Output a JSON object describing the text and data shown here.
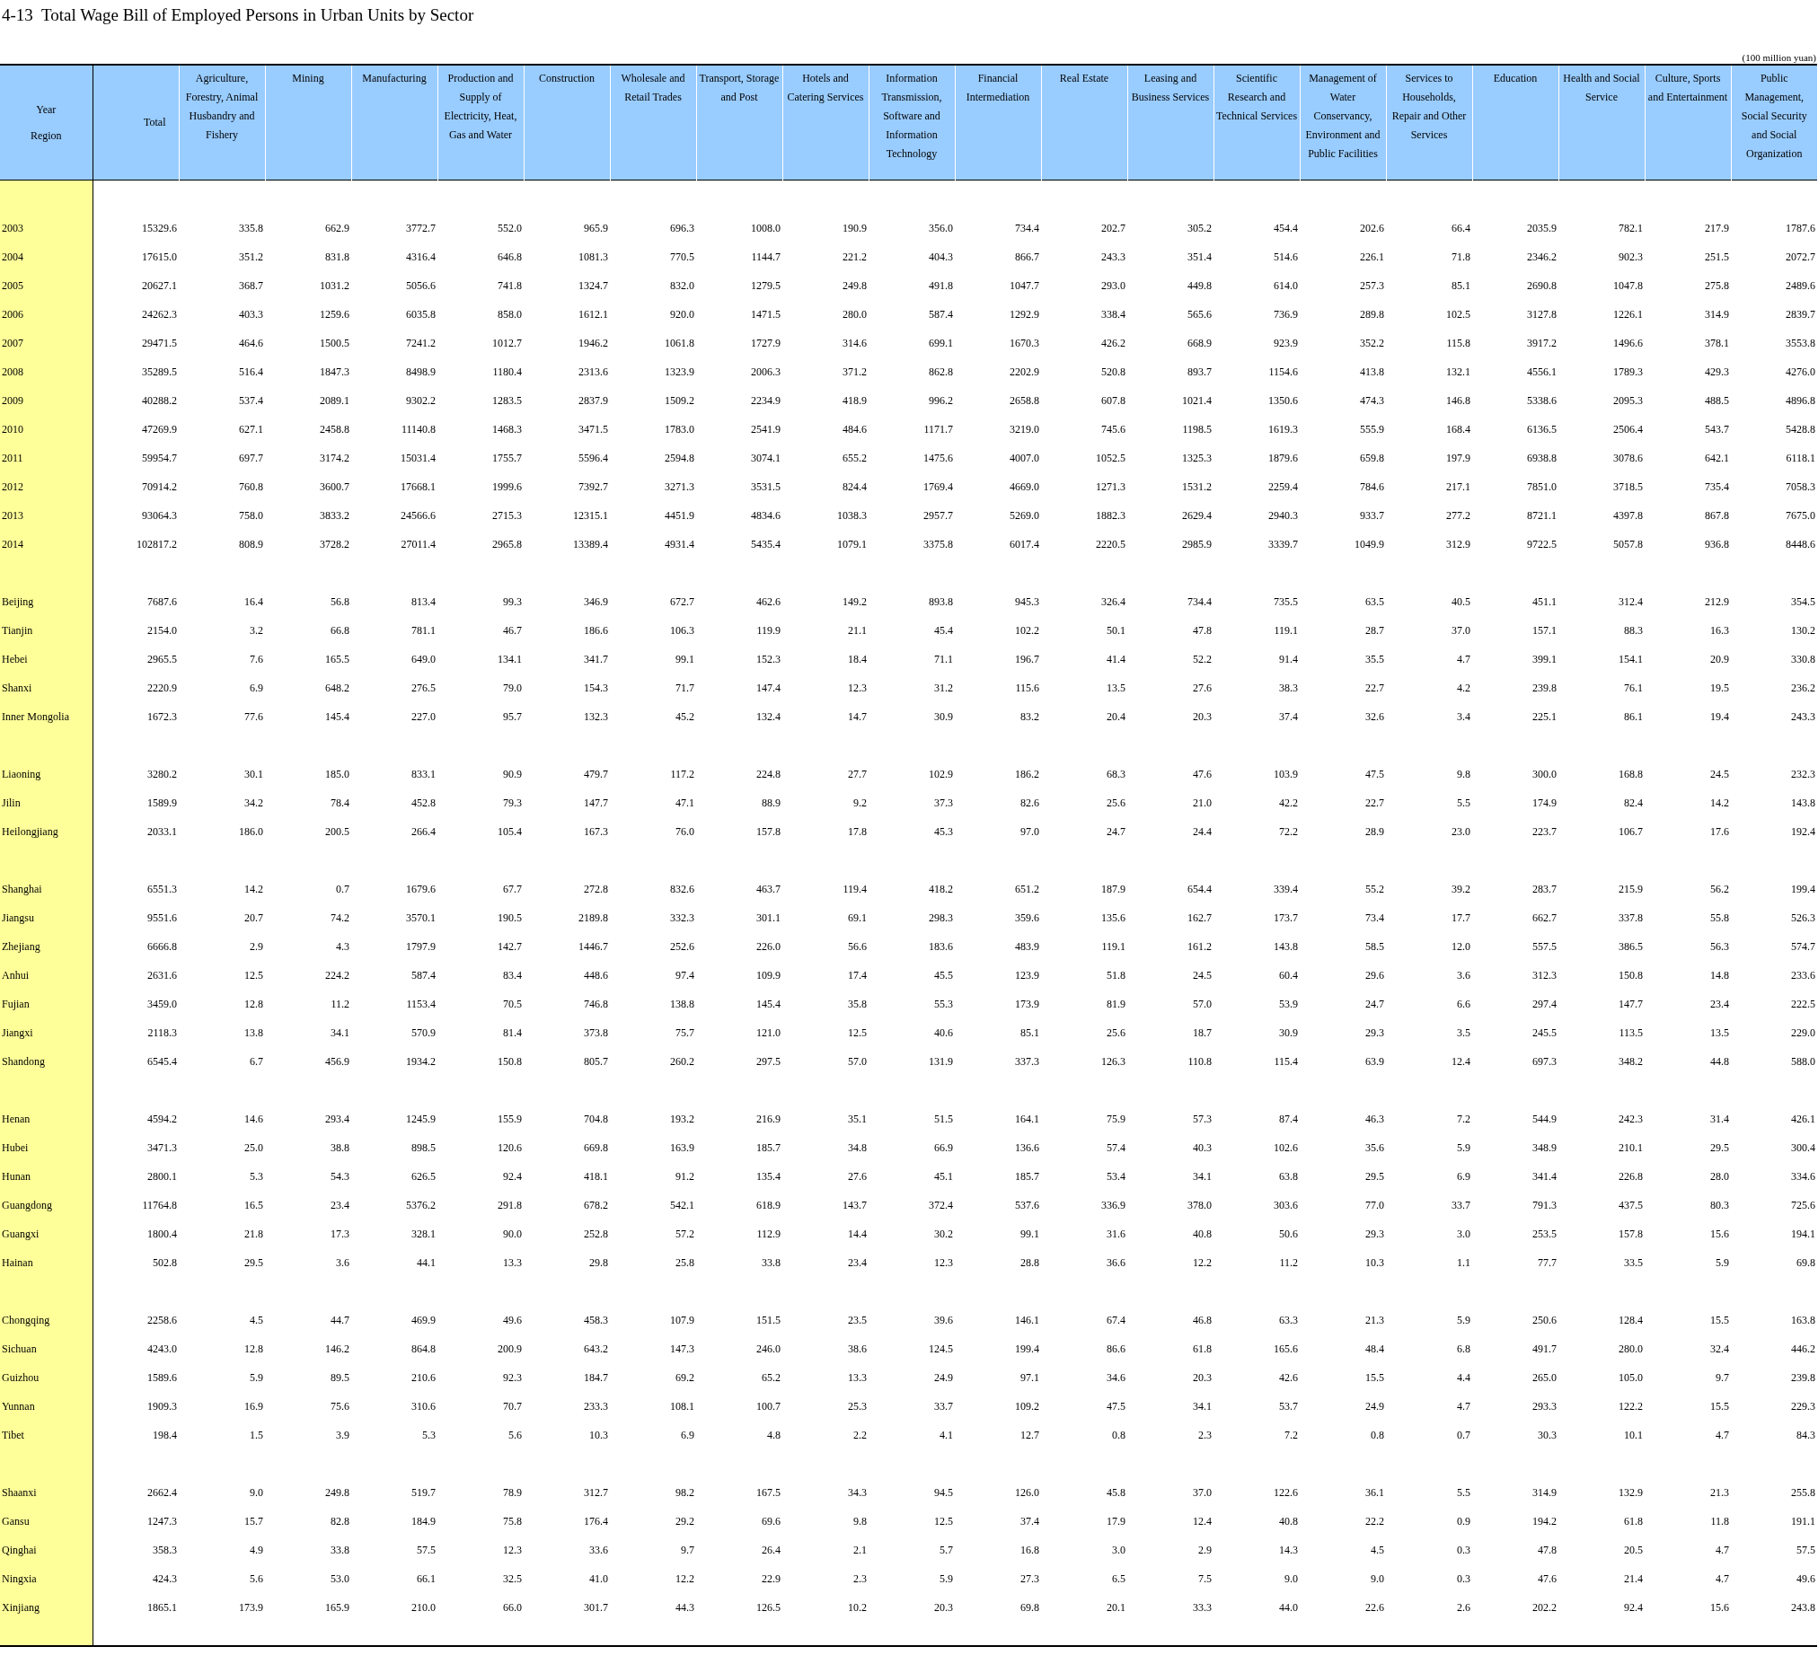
{
  "title": "4-13  Total Wage Bill of Employed Persons in Urban Units by Sector",
  "unit": "(100 million yuan)",
  "corner": {
    "top": "Year",
    "bottom": "Region"
  },
  "columns": [
    "Total",
    "Agriculture, Forestry, Animal Husbandry and Fishery",
    "Mining",
    "Manufacturing",
    "Production and Supply of Electricity, Heat, Gas and Water",
    "Construction",
    "Wholesale and Retail Trades",
    "Transport, Storage and Post",
    "Hotels and Catering Services",
    "Information Transmission, Software and Information Technology",
    "Financial Intermediation",
    "Real Estate",
    "Leasing and Business Services",
    "Scientific Research and Technical Services",
    "Management of Water Conservancy, Environment and Public Facilities",
    "Services to Households, Repair and Other Services",
    "Education",
    "Health and Social Service",
    "Culture, Sports and Entertainment",
    "Public Management, Social Security and Social Organization"
  ],
  "sections": [
    {
      "rows": [
        {
          "label": "2003",
          "values": [
            "15329.6",
            "335.8",
            "662.9",
            "3772.7",
            "552.0",
            "965.9",
            "696.3",
            "1008.0",
            "190.9",
            "356.0",
            "734.4",
            "202.7",
            "305.2",
            "454.4",
            "202.6",
            "66.4",
            "2035.9",
            "782.1",
            "217.9",
            "1787.6"
          ]
        },
        {
          "label": "2004",
          "values": [
            "17615.0",
            "351.2",
            "831.8",
            "4316.4",
            "646.8",
            "1081.3",
            "770.5",
            "1144.7",
            "221.2",
            "404.3",
            "866.7",
            "243.3",
            "351.4",
            "514.6",
            "226.1",
            "71.8",
            "2346.2",
            "902.3",
            "251.5",
            "2072.7"
          ]
        },
        {
          "label": "2005",
          "values": [
            "20627.1",
            "368.7",
            "1031.2",
            "5056.6",
            "741.8",
            "1324.7",
            "832.0",
            "1279.5",
            "249.8",
            "491.8",
            "1047.7",
            "293.0",
            "449.8",
            "614.0",
            "257.3",
            "85.1",
            "2690.8",
            "1047.8",
            "275.8",
            "2489.6"
          ]
        },
        {
          "label": "2006",
          "values": [
            "24262.3",
            "403.3",
            "1259.6",
            "6035.8",
            "858.0",
            "1612.1",
            "920.0",
            "1471.5",
            "280.0",
            "587.4",
            "1292.9",
            "338.4",
            "565.6",
            "736.9",
            "289.8",
            "102.5",
            "3127.8",
            "1226.1",
            "314.9",
            "2839.7"
          ]
        },
        {
          "label": "2007",
          "values": [
            "29471.5",
            "464.6",
            "1500.5",
            "7241.2",
            "1012.7",
            "1946.2",
            "1061.8",
            "1727.9",
            "314.6",
            "699.1",
            "1670.3",
            "426.2",
            "668.9",
            "923.9",
            "352.2",
            "115.8",
            "3917.2",
            "1496.6",
            "378.1",
            "3553.8"
          ]
        },
        {
          "label": "2008",
          "values": [
            "35289.5",
            "516.4",
            "1847.3",
            "8498.9",
            "1180.4",
            "2313.6",
            "1323.9",
            "2006.3",
            "371.2",
            "862.8",
            "2202.9",
            "520.8",
            "893.7",
            "1154.6",
            "413.8",
            "132.1",
            "4556.1",
            "1789.3",
            "429.3",
            "4276.0"
          ]
        },
        {
          "label": "2009",
          "values": [
            "40288.2",
            "537.4",
            "2089.1",
            "9302.2",
            "1283.5",
            "2837.9",
            "1509.2",
            "2234.9",
            "418.9",
            "996.2",
            "2658.8",
            "607.8",
            "1021.4",
            "1350.6",
            "474.3",
            "146.8",
            "5338.6",
            "2095.3",
            "488.5",
            "4896.8"
          ]
        },
        {
          "label": "2010",
          "values": [
            "47269.9",
            "627.1",
            "2458.8",
            "11140.8",
            "1468.3",
            "3471.5",
            "1783.0",
            "2541.9",
            "484.6",
            "1171.7",
            "3219.0",
            "745.6",
            "1198.5",
            "1619.3",
            "555.9",
            "168.4",
            "6136.5",
            "2506.4",
            "543.7",
            "5428.8"
          ]
        },
        {
          "label": "2011",
          "values": [
            "59954.7",
            "697.7",
            "3174.2",
            "15031.4",
            "1755.7",
            "5596.4",
            "2594.8",
            "3074.1",
            "655.2",
            "1475.6",
            "4007.0",
            "1052.5",
            "1325.3",
            "1879.6",
            "659.8",
            "197.9",
            "6938.8",
            "3078.6",
            "642.1",
            "6118.1"
          ]
        },
        {
          "label": "2012",
          "values": [
            "70914.2",
            "760.8",
            "3600.7",
            "17668.1",
            "1999.6",
            "7392.7",
            "3271.3",
            "3531.5",
            "824.4",
            "1769.4",
            "4669.0",
            "1271.3",
            "1531.2",
            "2259.4",
            "784.6",
            "217.1",
            "7851.0",
            "3718.5",
            "735.4",
            "7058.3"
          ]
        },
        {
          "label": "2013",
          "values": [
            "93064.3",
            "758.0",
            "3833.2",
            "24566.6",
            "2715.3",
            "12315.1",
            "4451.9",
            "4834.6",
            "1038.3",
            "2957.7",
            "5269.0",
            "1882.3",
            "2629.4",
            "2940.3",
            "933.7",
            "277.2",
            "8721.1",
            "4397.8",
            "867.8",
            "7675.0"
          ]
        },
        {
          "label": "2014",
          "values": [
            "102817.2",
            "808.9",
            "3728.2",
            "27011.4",
            "2965.8",
            "13389.4",
            "4931.4",
            "5435.4",
            "1079.1",
            "3375.8",
            "6017.4",
            "2220.5",
            "2985.9",
            "3339.7",
            "1049.9",
            "312.9",
            "9722.5",
            "5057.8",
            "936.8",
            "8448.6"
          ]
        }
      ]
    },
    {
      "rows": [
        {
          "label": "Beijing",
          "values": [
            "7687.6",
            "16.4",
            "56.8",
            "813.4",
            "99.3",
            "346.9",
            "672.7",
            "462.6",
            "149.2",
            "893.8",
            "945.3",
            "326.4",
            "734.4",
            "735.5",
            "63.5",
            "40.5",
            "451.1",
            "312.4",
            "212.9",
            "354.5"
          ]
        },
        {
          "label": "Tianjin",
          "values": [
            "2154.0",
            "3.2",
            "66.8",
            "781.1",
            "46.7",
            "186.6",
            "106.3",
            "119.9",
            "21.1",
            "45.4",
            "102.2",
            "50.1",
            "47.8",
            "119.1",
            "28.7",
            "37.0",
            "157.1",
            "88.3",
            "16.3",
            "130.2"
          ]
        },
        {
          "label": "Hebei",
          "values": [
            "2965.5",
            "7.6",
            "165.5",
            "649.0",
            "134.1",
            "341.7",
            "99.1",
            "152.3",
            "18.4",
            "71.1",
            "196.7",
            "41.4",
            "52.2",
            "91.4",
            "35.5",
            "4.7",
            "399.1",
            "154.1",
            "20.9",
            "330.8"
          ]
        },
        {
          "label": "Shanxi",
          "values": [
            "2220.9",
            "6.9",
            "648.2",
            "276.5",
            "79.0",
            "154.3",
            "71.7",
            "147.4",
            "12.3",
            "31.2",
            "115.6",
            "13.5",
            "27.6",
            "38.3",
            "22.7",
            "4.2",
            "239.8",
            "76.1",
            "19.5",
            "236.2"
          ]
        },
        {
          "label": "Inner Mongolia",
          "values": [
            "1672.3",
            "77.6",
            "145.4",
            "227.0",
            "95.7",
            "132.3",
            "45.2",
            "132.4",
            "14.7",
            "30.9",
            "83.2",
            "20.4",
            "20.3",
            "37.4",
            "32.6",
            "3.4",
            "225.1",
            "86.1",
            "19.4",
            "243.3"
          ]
        }
      ]
    },
    {
      "rows": [
        {
          "label": "Liaoning",
          "values": [
            "3280.2",
            "30.1",
            "185.0",
            "833.1",
            "90.9",
            "479.7",
            "117.2",
            "224.8",
            "27.7",
            "102.9",
            "186.2",
            "68.3",
            "47.6",
            "103.9",
            "47.5",
            "9.8",
            "300.0",
            "168.8",
            "24.5",
            "232.3"
          ]
        },
        {
          "label": "Jilin",
          "values": [
            "1589.9",
            "34.2",
            "78.4",
            "452.8",
            "79.3",
            "147.7",
            "47.1",
            "88.9",
            "9.2",
            "37.3",
            "82.6",
            "25.6",
            "21.0",
            "42.2",
            "22.7",
            "5.5",
            "174.9",
            "82.4",
            "14.2",
            "143.8"
          ]
        },
        {
          "label": "Heilongjiang",
          "values": [
            "2033.1",
            "186.0",
            "200.5",
            "266.4",
            "105.4",
            "167.3",
            "76.0",
            "157.8",
            "17.8",
            "45.3",
            "97.0",
            "24.7",
            "24.4",
            "72.2",
            "28.9",
            "23.0",
            "223.7",
            "106.7",
            "17.6",
            "192.4"
          ]
        }
      ]
    },
    {
      "rows": [
        {
          "label": "Shanghai",
          "values": [
            "6551.3",
            "14.2",
            "0.7",
            "1679.6",
            "67.7",
            "272.8",
            "832.6",
            "463.7",
            "119.4",
            "418.2",
            "651.2",
            "187.9",
            "654.4",
            "339.4",
            "55.2",
            "39.2",
            "283.7",
            "215.9",
            "56.2",
            "199.4"
          ]
        },
        {
          "label": "Jiangsu",
          "values": [
            "9551.6",
            "20.7",
            "74.2",
            "3570.1",
            "190.5",
            "2189.8",
            "332.3",
            "301.1",
            "69.1",
            "298.3",
            "359.6",
            "135.6",
            "162.7",
            "173.7",
            "73.4",
            "17.7",
            "662.7",
            "337.8",
            "55.8",
            "526.3"
          ]
        },
        {
          "label": "Zhejiang",
          "values": [
            "6666.8",
            "2.9",
            "4.3",
            "1797.9",
            "142.7",
            "1446.7",
            "252.6",
            "226.0",
            "56.6",
            "183.6",
            "483.9",
            "119.1",
            "161.2",
            "143.8",
            "58.5",
            "12.0",
            "557.5",
            "386.5",
            "56.3",
            "574.7"
          ]
        },
        {
          "label": "Anhui",
          "values": [
            "2631.6",
            "12.5",
            "224.2",
            "587.4",
            "83.4",
            "448.6",
            "97.4",
            "109.9",
            "17.4",
            "45.5",
            "123.9",
            "51.8",
            "24.5",
            "60.4",
            "29.6",
            "3.6",
            "312.3",
            "150.8",
            "14.8",
            "233.6"
          ]
        },
        {
          "label": "Fujian",
          "values": [
            "3459.0",
            "12.8",
            "11.2",
            "1153.4",
            "70.5",
            "746.8",
            "138.8",
            "145.4",
            "35.8",
            "55.3",
            "173.9",
            "81.9",
            "57.0",
            "53.9",
            "24.7",
            "6.6",
            "297.4",
            "147.7",
            "23.4",
            "222.5"
          ]
        },
        {
          "label": "Jiangxi",
          "values": [
            "2118.3",
            "13.8",
            "34.1",
            "570.9",
            "81.4",
            "373.8",
            "75.7",
            "121.0",
            "12.5",
            "40.6",
            "85.1",
            "25.6",
            "18.7",
            "30.9",
            "29.3",
            "3.5",
            "245.5",
            "113.5",
            "13.5",
            "229.0"
          ]
        },
        {
          "label": "Shandong",
          "values": [
            "6545.4",
            "6.7",
            "456.9",
            "1934.2",
            "150.8",
            "805.7",
            "260.2",
            "297.5",
            "57.0",
            "131.9",
            "337.3",
            "126.3",
            "110.8",
            "115.4",
            "63.9",
            "12.4",
            "697.3",
            "348.2",
            "44.8",
            "588.0"
          ]
        }
      ]
    },
    {
      "rows": [
        {
          "label": "Henan",
          "values": [
            "4594.2",
            "14.6",
            "293.4",
            "1245.9",
            "155.9",
            "704.8",
            "193.2",
            "216.9",
            "35.1",
            "51.5",
            "164.1",
            "75.9",
            "57.3",
            "87.4",
            "46.3",
            "7.2",
            "544.9",
            "242.3",
            "31.4",
            "426.1"
          ]
        },
        {
          "label": "Hubei",
          "values": [
            "3471.3",
            "25.0",
            "38.8",
            "898.5",
            "120.6",
            "669.8",
            "163.9",
            "185.7",
            "34.8",
            "66.9",
            "136.6",
            "57.4",
            "40.3",
            "102.6",
            "35.6",
            "5.9",
            "348.9",
            "210.1",
            "29.5",
            "300.4"
          ]
        },
        {
          "label": "Hunan",
          "values": [
            "2800.1",
            "5.3",
            "54.3",
            "626.5",
            "92.4",
            "418.1",
            "91.2",
            "135.4",
            "27.6",
            "45.1",
            "185.7",
            "53.4",
            "34.1",
            "63.8",
            "29.5",
            "6.9",
            "341.4",
            "226.8",
            "28.0",
            "334.6"
          ]
        },
        {
          "label": "Guangdong",
          "values": [
            "11764.8",
            "16.5",
            "23.4",
            "5376.2",
            "291.8",
            "678.2",
            "542.1",
            "618.9",
            "143.7",
            "372.4",
            "537.6",
            "336.9",
            "378.0",
            "303.6",
            "77.0",
            "33.7",
            "791.3",
            "437.5",
            "80.3",
            "725.6"
          ]
        },
        {
          "label": "Guangxi",
          "values": [
            "1800.4",
            "21.8",
            "17.3",
            "328.1",
            "90.0",
            "252.8",
            "57.2",
            "112.9",
            "14.4",
            "30.2",
            "99.1",
            "31.6",
            "40.8",
            "50.6",
            "29.3",
            "3.0",
            "253.5",
            "157.8",
            "15.6",
            "194.1"
          ]
        },
        {
          "label": "Hainan",
          "values": [
            "502.8",
            "29.5",
            "3.6",
            "44.1",
            "13.3",
            "29.8",
            "25.8",
            "33.8",
            "23.4",
            "12.3",
            "28.8",
            "36.6",
            "12.2",
            "11.2",
            "10.3",
            "1.1",
            "77.7",
            "33.5",
            "5.9",
            "69.8"
          ]
        }
      ]
    },
    {
      "rows": [
        {
          "label": "Chongqing",
          "values": [
            "2258.6",
            "4.5",
            "44.7",
            "469.9",
            "49.6",
            "458.3",
            "107.9",
            "151.5",
            "23.5",
            "39.6",
            "146.1",
            "67.4",
            "46.8",
            "63.3",
            "21.3",
            "5.9",
            "250.6",
            "128.4",
            "15.5",
            "163.8"
          ]
        },
        {
          "label": "Sichuan",
          "values": [
            "4243.0",
            "12.8",
            "146.2",
            "864.8",
            "200.9",
            "643.2",
            "147.3",
            "246.0",
            "38.6",
            "124.5",
            "199.4",
            "86.6",
            "61.8",
            "165.6",
            "48.4",
            "6.8",
            "491.7",
            "280.0",
            "32.4",
            "446.2"
          ]
        },
        {
          "label": "Guizhou",
          "values": [
            "1589.6",
            "5.9",
            "89.5",
            "210.6",
            "92.3",
            "184.7",
            "69.2",
            "65.2",
            "13.3",
            "24.9",
            "97.1",
            "34.6",
            "20.3",
            "42.6",
            "15.5",
            "4.4",
            "265.0",
            "105.0",
            "9.7",
            "239.8"
          ]
        },
        {
          "label": "Yunnan",
          "values": [
            "1909.3",
            "16.9",
            "75.6",
            "310.6",
            "70.7",
            "233.3",
            "108.1",
            "100.7",
            "25.3",
            "33.7",
            "109.2",
            "47.5",
            "34.1",
            "53.7",
            "24.9",
            "4.7",
            "293.3",
            "122.2",
            "15.5",
            "229.3"
          ]
        },
        {
          "label": "Tibet",
          "values": [
            "198.4",
            "1.5",
            "3.9",
            "5.3",
            "5.6",
            "10.3",
            "6.9",
            "4.8",
            "2.2",
            "4.1",
            "12.7",
            "0.8",
            "2.3",
            "7.2",
            "0.8",
            "0.7",
            "30.3",
            "10.1",
            "4.7",
            "84.3"
          ]
        }
      ]
    },
    {
      "rows": [
        {
          "label": "Shaanxi",
          "values": [
            "2662.4",
            "9.0",
            "249.8",
            "519.7",
            "78.9",
            "312.7",
            "98.2",
            "167.5",
            "34.3",
            "94.5",
            "126.0",
            "45.8",
            "37.0",
            "122.6",
            "36.1",
            "5.5",
            "314.9",
            "132.9",
            "21.3",
            "255.8"
          ]
        },
        {
          "label": "Gansu",
          "values": [
            "1247.3",
            "15.7",
            "82.8",
            "184.9",
            "75.8",
            "176.4",
            "29.2",
            "69.6",
            "9.8",
            "12.5",
            "37.4",
            "17.9",
            "12.4",
            "40.8",
            "22.2",
            "0.9",
            "194.2",
            "61.8",
            "11.8",
            "191.1"
          ]
        },
        {
          "label": "Qinghai",
          "values": [
            "358.3",
            "4.9",
            "33.8",
            "57.5",
            "12.3",
            "33.6",
            "9.7",
            "26.4",
            "2.1",
            "5.7",
            "16.8",
            "3.0",
            "2.9",
            "14.3",
            "4.5",
            "0.3",
            "47.8",
            "20.5",
            "4.7",
            "57.5"
          ]
        },
        {
          "label": "Ningxia",
          "values": [
            "424.3",
            "5.6",
            "53.0",
            "66.1",
            "32.5",
            "41.0",
            "12.2",
            "22.9",
            "2.3",
            "5.9",
            "27.3",
            "6.5",
            "7.5",
            "9.0",
            "9.0",
            "0.3",
            "47.6",
            "21.4",
            "4.7",
            "49.6"
          ]
        },
        {
          "label": "Xinjiang",
          "values": [
            "1865.1",
            "173.9",
            "165.9",
            "210.0",
            "66.0",
            "301.7",
            "44.3",
            "126.5",
            "10.2",
            "20.3",
            "69.8",
            "20.1",
            "33.3",
            "44.0",
            "22.6",
            "2.6",
            "202.2",
            "92.4",
            "15.6",
            "243.8"
          ]
        }
      ]
    }
  ]
}
